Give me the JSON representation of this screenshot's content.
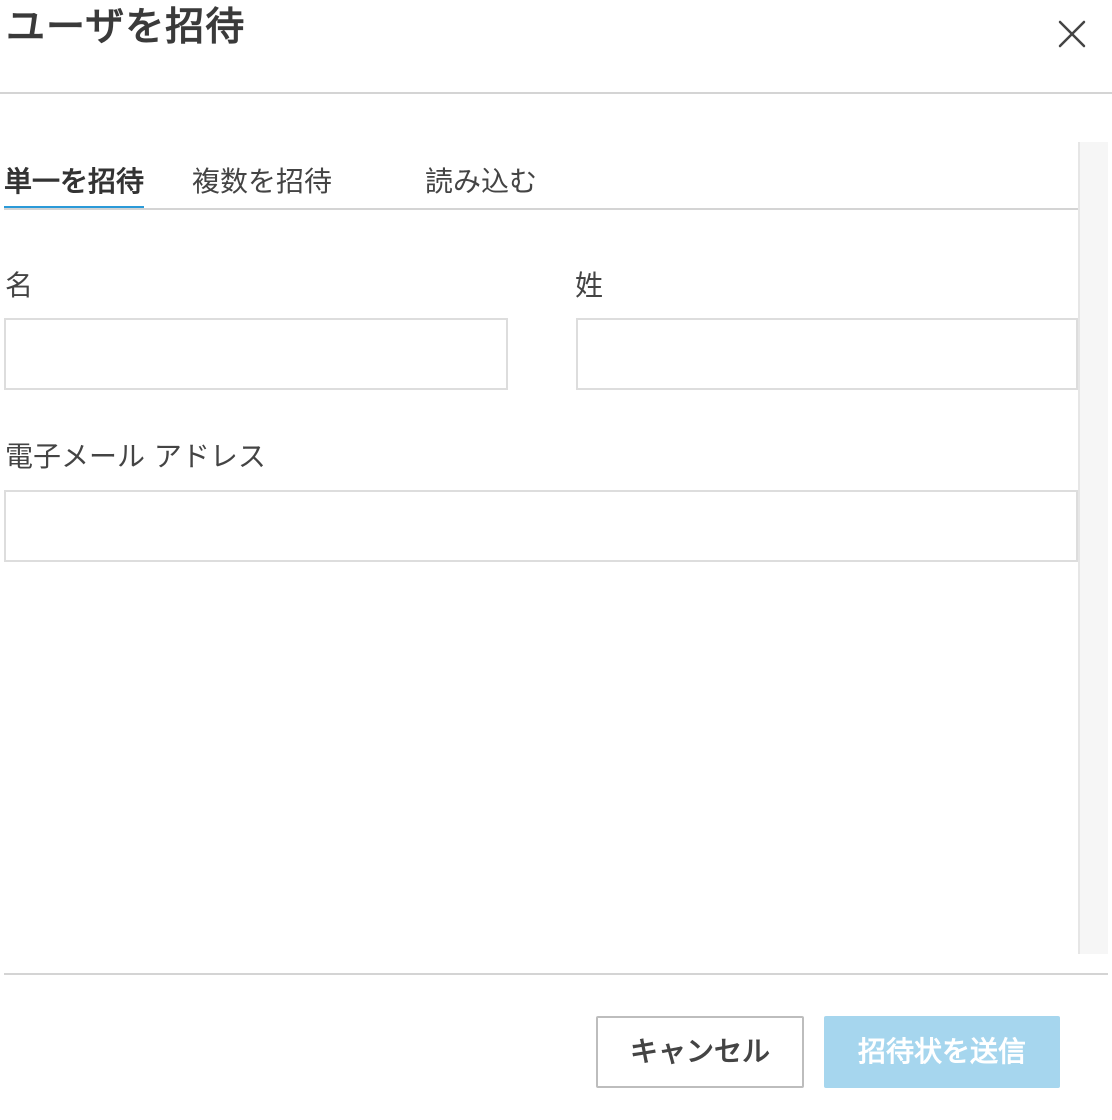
{
  "dialog": {
    "title": "ユーザを招待",
    "close_icon": "close-icon"
  },
  "tabs": [
    {
      "label": "単一を招待",
      "active": true,
      "underline_color": "#2b9ad8"
    },
    {
      "label": "複数を招待",
      "active": false,
      "underline_color": "#9a9a9a"
    },
    {
      "label": "読み込む",
      "active": false
    }
  ],
  "form": {
    "first_name": {
      "label": "名",
      "value": "",
      "placeholder": ""
    },
    "last_name": {
      "label": "姓",
      "value": "",
      "placeholder": ""
    },
    "email": {
      "label": "電子メール アドレス",
      "value": "",
      "placeholder": ""
    }
  },
  "footer": {
    "cancel_label": "キャンセル",
    "send_label": "招待状を送信",
    "send_disabled": true
  },
  "colors": {
    "accent": "#2b9ad8",
    "send_button_disabled": "#a6d6ee",
    "border": "#dddddd"
  }
}
